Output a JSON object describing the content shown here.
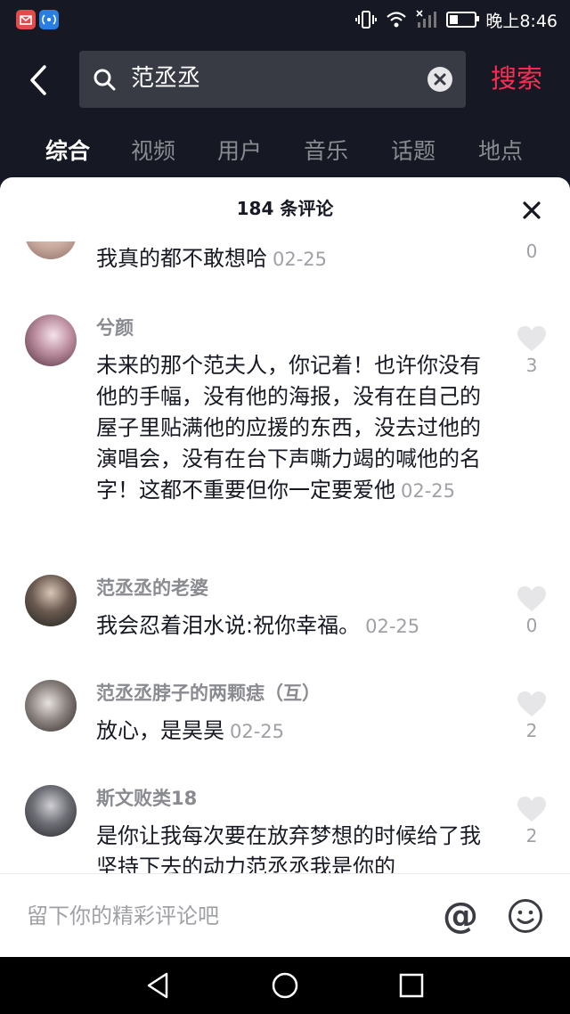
{
  "status_bar": {
    "time": "晚上8:46",
    "battery_level": 0.35,
    "app_icons": [
      "mail-app-icon",
      "wireless-app-icon"
    ],
    "colors": {
      "mail_app": "#e24b4b",
      "wireless_app": "#2a7de1"
    }
  },
  "search": {
    "query": "范丞丞",
    "button_label": "搜索",
    "button_color": "#fe2c55"
  },
  "tabs": [
    {
      "label": "综合",
      "active": true
    },
    {
      "label": "视频",
      "active": false
    },
    {
      "label": "用户",
      "active": false
    },
    {
      "label": "音乐",
      "active": false
    },
    {
      "label": "话题",
      "active": false
    },
    {
      "label": "地点",
      "active": false
    }
  ],
  "comments_sheet": {
    "title": "184 条评论",
    "comments": [
      {
        "user": "",
        "text": "我真的都不敢想哈",
        "date": "02-25",
        "likes": "0"
      },
      {
        "user": "兮颜",
        "text": "未来的那个范夫人，你记着！也许你没有他的手幅，没有他的海报，没有在自己的屋子里贴满他的应援的东西，没去过他的演唱会，没有在台下声嘶力竭的喊他的名字！这都不重要但你一定要爱他",
        "date": "02-25",
        "likes": "3"
      },
      {
        "user": "范丞丞的老婆",
        "text": "我会忍着泪水说:祝你幸福。",
        "date": "02-25",
        "likes": "0"
      },
      {
        "user": "范丞丞脖子的两颗痣（互）",
        "text": "放心，是昊昊",
        "date": "02-25",
        "likes": "2"
      },
      {
        "user": "斯文败类18",
        "text": "是你让我每次要在放弃梦想的时候给了我坚持下去的动力范丞丞我是你的",
        "date": "",
        "likes": "2"
      }
    ],
    "input_placeholder": "留下你的精彩评论吧",
    "at_symbol": "@"
  }
}
